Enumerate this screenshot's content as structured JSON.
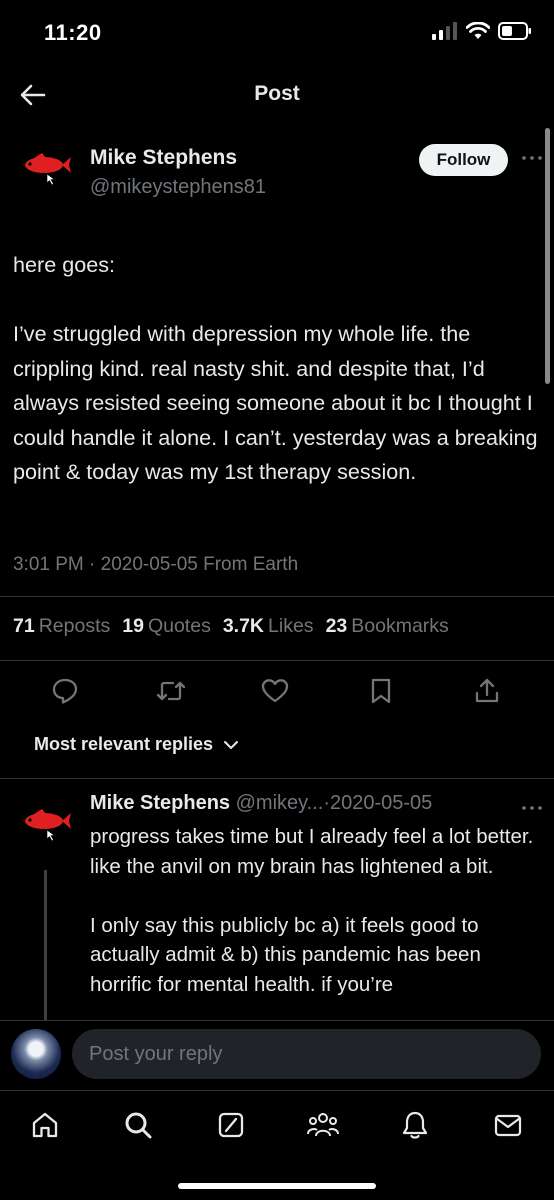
{
  "status_bar": {
    "time": "11:20"
  },
  "header": {
    "title": "Post"
  },
  "post": {
    "author_name": "Mike Stephens",
    "author_handle": "@mikeystephens81",
    "follow_label": "Follow",
    "avatar_icon": "red-fish-logo-icon",
    "text_paragraphs": [
      "here goes:",
      "I’ve struggled with depression my whole life. the crippling kind. real nasty shit. and despite that, I’d always resisted seeing someone about it bc I thought I could handle it alone. I can’t. yesterday was a breaking point & today was my 1st therapy session."
    ],
    "meta": "3:01 PM · 2020-05-05 From Earth"
  },
  "stats": {
    "reposts_count": "71",
    "reposts_label": "Reposts",
    "quotes_count": "19",
    "quotes_label": "Quotes",
    "likes_count": "3.7K",
    "likes_label": "Likes",
    "bookmarks_count": "23",
    "bookmarks_label": "Bookmarks"
  },
  "actions": [
    "reply-icon",
    "repost-icon",
    "like-icon",
    "bookmark-icon",
    "share-icon"
  ],
  "replies": {
    "sort_label": "Most relevant replies",
    "items": [
      {
        "name": "Mike Stephens",
        "handle": "@mikey...",
        "separator": "·",
        "date": "2020-05-05",
        "text_paragraphs": [
          "progress takes time but I already feel a lot better. like the anvil on my brain has lightened a bit.",
          "I only say this publicly bc a) it feels good to actually admit & b) this pandemic has been horrific for mental health. if you’re"
        ]
      }
    ]
  },
  "composer": {
    "placeholder": "Post your reply"
  },
  "tabbar": [
    "home-icon",
    "search-icon",
    "grok-icon",
    "communities-icon",
    "notifications-icon",
    "messages-icon"
  ],
  "colors": {
    "background": "#000000",
    "text": "#e7e9ea",
    "muted": "#71767b",
    "divider": "#2f3336",
    "brand_red": "#e02020"
  }
}
